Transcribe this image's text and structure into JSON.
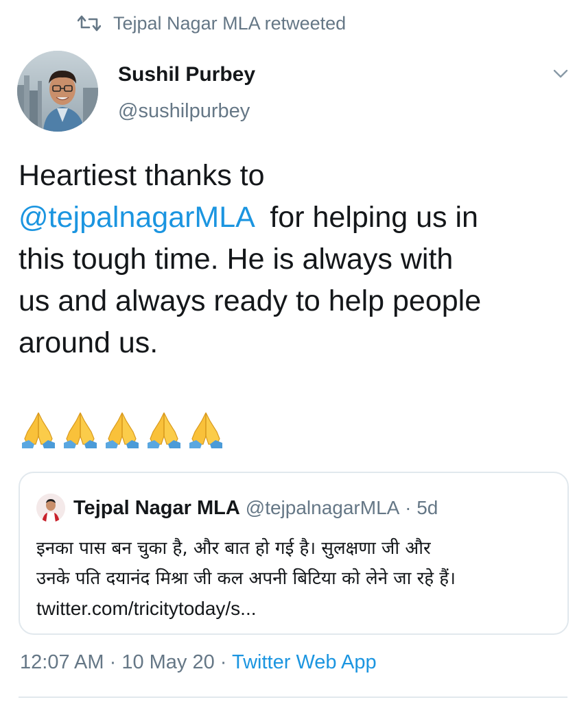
{
  "retweet": {
    "icon": "retweet-icon",
    "label": "Tejpal Nagar MLA retweeted"
  },
  "author": {
    "name": "Sushil Purbey",
    "handle": "@sushilpurbey",
    "avatar_icon": "user-avatar"
  },
  "menu_icon": "chevron-down-icon",
  "tweet": {
    "line1": "Heartiest thanks to",
    "mention": "@tejpalnagarMLA",
    "line2_rest": "  for helping us in",
    "line3": "this tough time. He is always with",
    "line4": "us and always ready to help people",
    "line5": "around us.",
    "emoji": [
      "folded-hands",
      "folded-hands",
      "folded-hands",
      "folded-hands",
      "folded-hands"
    ]
  },
  "quoted_tweet": {
    "name": "Tejpal Nagar MLA",
    "handle": "@tejpalnagarMLA",
    "separator": " · ",
    "age": "5d",
    "line1": "इनका पास बन चुका है, और बात हो गई है। सुलक्षणा जी और",
    "line2": "उनके पति दयानंद मिश्रा जी कल अपनी बिटिया को लेने जा रहे हैं।",
    "link": "twitter.com/tricitytoday/s..."
  },
  "footer": {
    "time": "12:07 AM",
    "separator1": " · ",
    "date": "10 May 20",
    "separator2": " · ",
    "source": "Twitter Web App"
  },
  "colors": {
    "link": "#1b95e0",
    "secondary_text": "#657786",
    "primary_text": "#14171a",
    "border": "#e1e8ed"
  }
}
